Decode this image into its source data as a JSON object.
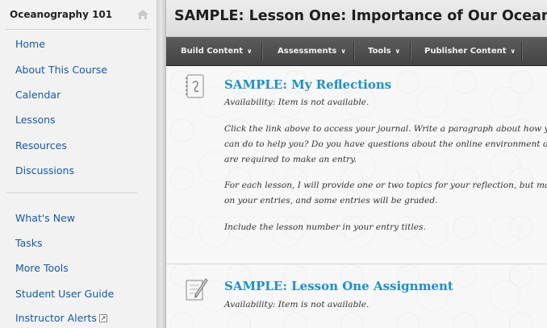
{
  "sidebar": {
    "course_title": "Oceanography 101",
    "primary_items": [
      {
        "label": "Home"
      },
      {
        "label": "About This Course"
      },
      {
        "label": "Calendar"
      },
      {
        "label": "Lessons"
      },
      {
        "label": "Resources"
      },
      {
        "label": "Discussions"
      }
    ],
    "secondary_items": [
      {
        "label": "What's New"
      },
      {
        "label": "Tasks"
      },
      {
        "label": "More Tools"
      },
      {
        "label": "Student User Guide"
      },
      {
        "label": "Instructor Alerts"
      }
    ]
  },
  "main": {
    "page_title": "SAMPLE: Lesson One: Importance of Our Oceans",
    "menu": [
      {
        "label": "Build Content"
      },
      {
        "label": "Assessments"
      },
      {
        "label": "Tools"
      },
      {
        "label": "Publisher Content"
      }
    ],
    "items": [
      {
        "title": "SAMPLE: My Reflections",
        "availability": "Availability:  Item is not available.",
        "para1_line1": "Click the link above to access your journal. Write a paragraph about how y",
        "para1_line2": "can do to help you? Do you have questions about the online environment or",
        "para1_line3": "are required to make an entry.",
        "para2_line1": "For each lesson, I will provide one or two topics for your reflection, but mak",
        "para2_line2": "on your entries, and some entries will be graded.",
        "para3_line1": "Include the lesson number in your entry titles."
      },
      {
        "title": "SAMPLE: Lesson One Assignment",
        "availability": "Availability:  Item is not available."
      }
    ]
  },
  "colors": {
    "link": "#1a57a3",
    "item_title": "#1d8fc9",
    "menubar": "#4d4d4d"
  }
}
